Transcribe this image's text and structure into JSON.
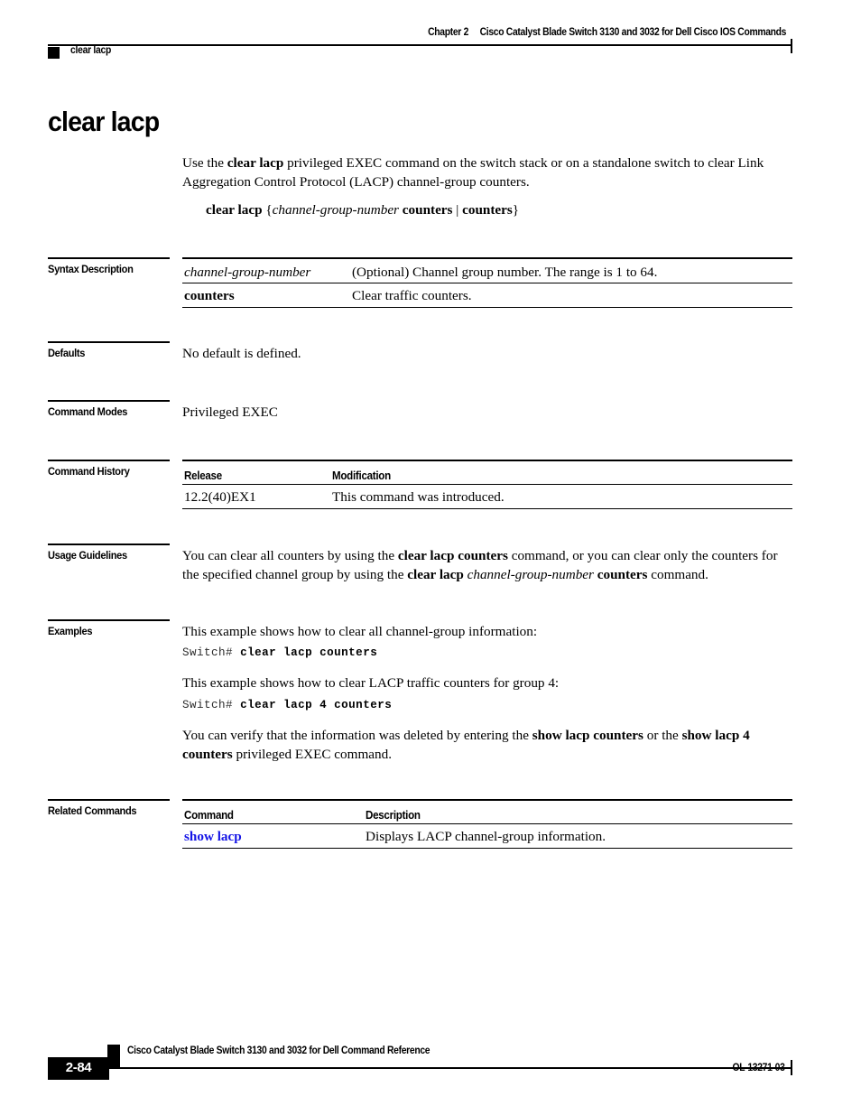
{
  "header": {
    "chapter": "Chapter 2",
    "book_title": "Cisco Catalyst Blade Switch 3130 and 3032 for Dell Cisco IOS Commands",
    "command_name": "clear lacp"
  },
  "title": "clear lacp",
  "intro": {
    "line1_pre": "Use the ",
    "line1_bold": "clear lacp",
    "line1_post": " privileged EXEC command on the switch stack or on a standalone switch to clear Link Aggregation Control Protocol (LACP) channel-group counters."
  },
  "syntax": {
    "command": "clear lacp",
    "open_brace": " {",
    "arg_italic": "channel-group-number",
    "arg_bold": " counters",
    "separator": " | ",
    "alt_bold": "counters",
    "close_brace": "}"
  },
  "sections": {
    "syntax_description": {
      "label": "Syntax Description",
      "rows": [
        {
          "term": "channel-group-number",
          "term_style": "italic",
          "description": "(Optional) Channel group number. The range is 1 to 64."
        },
        {
          "term": "counters",
          "term_style": "bold",
          "description": "Clear traffic counters."
        }
      ]
    },
    "defaults": {
      "label": "Defaults",
      "text": "No default is defined."
    },
    "command_modes": {
      "label": "Command Modes",
      "text": "Privileged EXEC"
    },
    "command_history": {
      "label": "Command History",
      "headers": {
        "release": "Release",
        "modification": "Modification"
      },
      "rows": [
        {
          "release": "12.2(40)EX1",
          "modification": "This command was introduced."
        }
      ]
    },
    "usage_guidelines": {
      "label": "Usage Guidelines",
      "pre1": "You can clear all counters by using the ",
      "bold1": "clear lacp counters",
      "mid1": " command, or you can clear only the counters for the specified channel group by using the ",
      "bold2": "clear lacp",
      "italic2": " channel-group-number",
      "bold3": " counters",
      "post2": " command."
    },
    "examples": {
      "label": "Examples",
      "intro1": "This example shows how to clear all channel-group information:",
      "code1_prompt": "Switch# ",
      "code1_command": "clear lacp counters",
      "intro2": "This example shows how to clear LACP traffic counters for group 4:",
      "code2_prompt": "Switch# ",
      "code2_command": "clear lacp 4 counters",
      "verify_pre": "You can verify that the information was deleted by entering the ",
      "verify_bold1": "show lacp counters",
      "verify_mid": " or the ",
      "verify_bold2": "show lacp 4 counters",
      "verify_post": " privileged EXEC command."
    },
    "related_commands": {
      "label": "Related Commands",
      "headers": {
        "command": "Command",
        "description": "Description"
      },
      "rows": [
        {
          "command": "show lacp",
          "description": "Displays LACP channel-group information.",
          "is_link": true
        }
      ]
    }
  },
  "footer": {
    "book_title": "Cisco Catalyst Blade Switch 3130 and 3032 for Dell Command Reference",
    "page_number": "2-84",
    "doc_id": "OL-13271-03"
  },
  "colors": {
    "link": "#1414e6",
    "rule": "#000000",
    "page_background": "#ffffff"
  }
}
